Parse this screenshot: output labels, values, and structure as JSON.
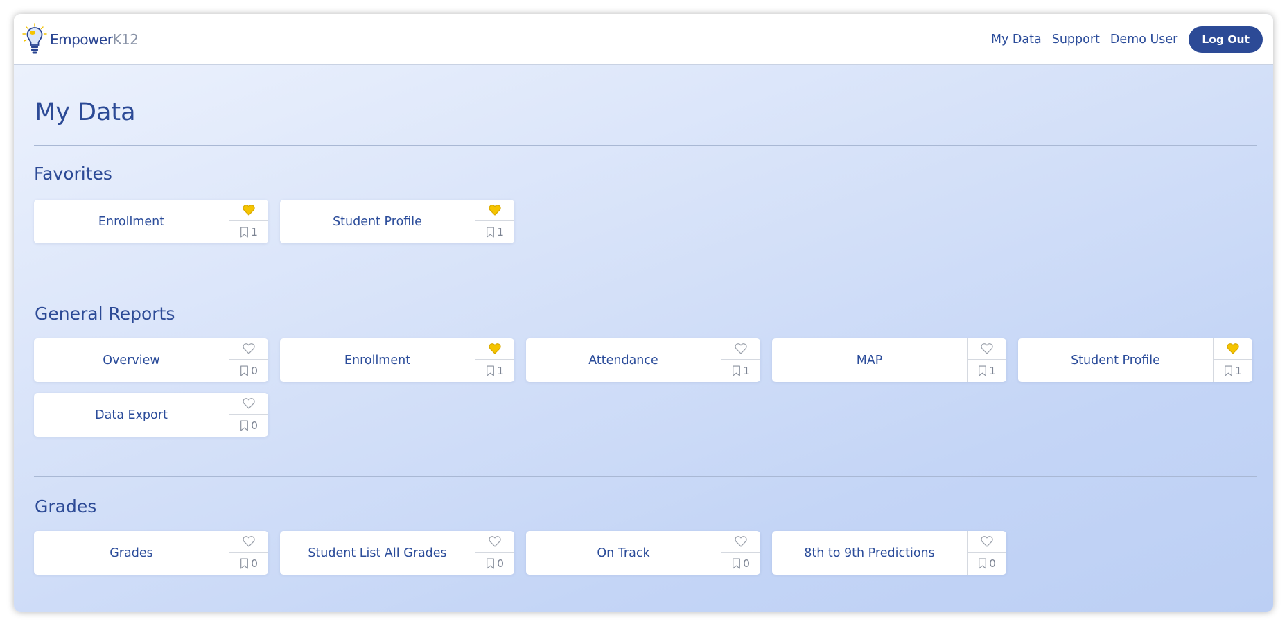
{
  "brand": {
    "name_part1": "Empower",
    "name_part2": "K12"
  },
  "nav": {
    "links": [
      "My Data",
      "Support",
      "Demo User"
    ],
    "logout_label": "Log Out"
  },
  "page": {
    "title": "My Data"
  },
  "colors": {
    "primary": "#2c4a96",
    "favorite_active": "#f5c400",
    "favorite_inactive": "#9aa0aa"
  },
  "sections": [
    {
      "title": "Favorites",
      "cards": [
        {
          "name": "Enrollment",
          "favorite": true,
          "bookmarks": "1"
        },
        {
          "name": "Student Profile",
          "favorite": true,
          "bookmarks": "1"
        }
      ]
    },
    {
      "title": "General Reports",
      "cards": [
        {
          "name": "Overview",
          "favorite": false,
          "bookmarks": "0"
        },
        {
          "name": "Enrollment",
          "favorite": true,
          "bookmarks": "1"
        },
        {
          "name": "Attendance",
          "favorite": false,
          "bookmarks": "1"
        },
        {
          "name": "MAP",
          "favorite": false,
          "bookmarks": "1"
        },
        {
          "name": "Student Profile",
          "favorite": true,
          "bookmarks": "1"
        },
        {
          "name": "Data Export",
          "favorite": false,
          "bookmarks": "0"
        }
      ]
    },
    {
      "title": "Grades",
      "cards": [
        {
          "name": "Grades",
          "favorite": false,
          "bookmarks": "0"
        },
        {
          "name": "Student List All Grades",
          "favorite": false,
          "bookmarks": "0"
        },
        {
          "name": "On Track",
          "favorite": false,
          "bookmarks": "0"
        },
        {
          "name": "8th to 9th Predictions",
          "favorite": false,
          "bookmarks": "0"
        }
      ]
    }
  ]
}
